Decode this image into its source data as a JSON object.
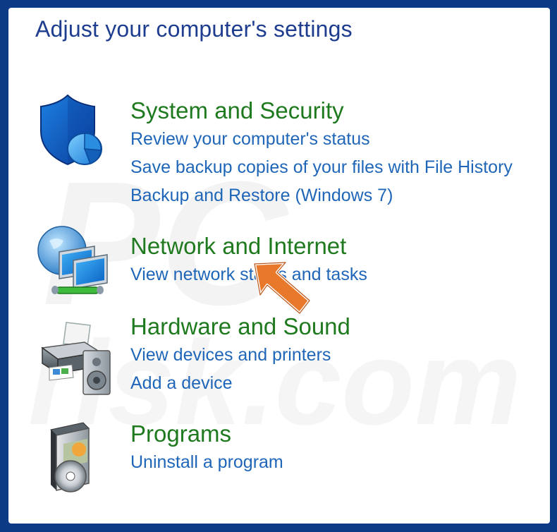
{
  "window": {
    "title": "Adjust your computer's settings"
  },
  "categories": [
    {
      "heading": "System and Security",
      "icon": "shield-icon",
      "links": [
        "Review your computer's status",
        "Save backup copies of your files with File History",
        "Backup and Restore (Windows 7)"
      ]
    },
    {
      "heading": "Network and Internet",
      "icon": "network-globe-icon",
      "links": [
        "View network status and tasks"
      ]
    },
    {
      "heading": "Hardware and Sound",
      "icon": "printer-speaker-icon",
      "links": [
        "View devices and printers",
        "Add a device"
      ]
    },
    {
      "heading": "Programs",
      "icon": "programs-disc-icon",
      "links": [
        "Uninstall a program"
      ]
    }
  ],
  "watermark": "PC risk.com",
  "colors": {
    "background_frame": "#0d3a84",
    "title": "#1e3d8f",
    "heading": "#1f7a1f",
    "link": "#1f66b8",
    "pointer_arrow": "#e8792a"
  }
}
